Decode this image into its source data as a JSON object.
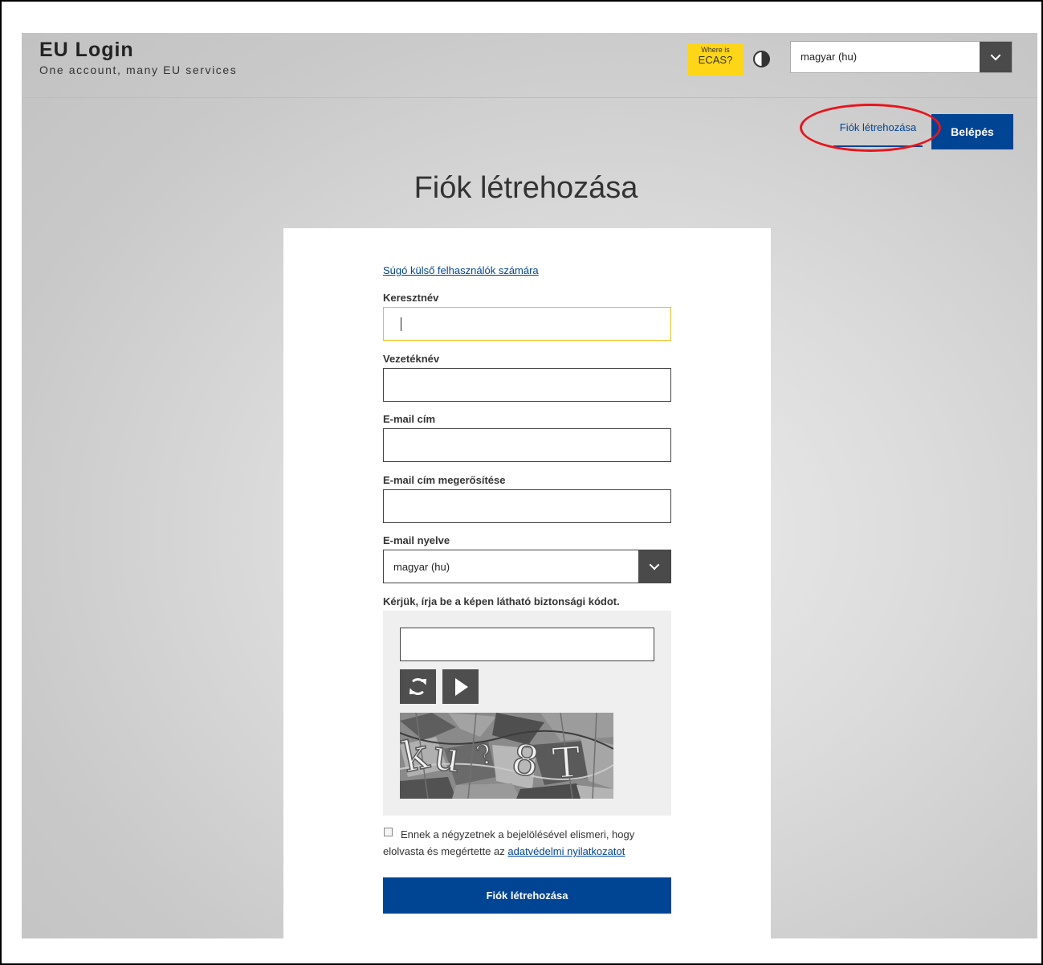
{
  "header": {
    "brand_title": "EU Login",
    "brand_subtitle": "One account, many EU services",
    "ecas_line1": "Where is",
    "ecas_line2": "ECAS?",
    "language_selected": "magyar (hu)"
  },
  "nav": {
    "create_account_label": "Fiók létrehozása",
    "login_label": "Belépés",
    "highlight_color": "#e8141b"
  },
  "page": {
    "title": "Fiók létrehozása"
  },
  "form": {
    "help_link": "Súgó külső felhasználók számára",
    "first_name_label": "Keresztnév",
    "first_name_value": "",
    "last_name_label": "Vezetéknév",
    "last_name_value": "",
    "email_label": "E-mail cím",
    "email_value": "",
    "email_confirm_label": "E-mail cím megerősítése",
    "email_confirm_value": "",
    "email_language_label": "E-mail nyelve",
    "email_language_selected": "magyar (hu)",
    "captcha_label": "Kérjük, írja be a képen látható biztonsági kódot.",
    "captcha_value": "",
    "consent_text": "Ennek a négyzetnek a bejelölésével elismeri, hogy elolvasta és megértette az",
    "consent_link": "adatvédelmi nyilatkozatot",
    "consent_checked": false,
    "submit_label": "Fiók létrehozása"
  },
  "icons": {
    "contrast": "contrast-icon",
    "dropdown": "chevron-down-icon",
    "refresh": "refresh-icon",
    "play": "play-icon"
  },
  "colors": {
    "primary": "#004494",
    "ecas_yellow": "#ffd617",
    "focus_border": "#e8c11a",
    "dark_button": "#4e4e4e"
  }
}
